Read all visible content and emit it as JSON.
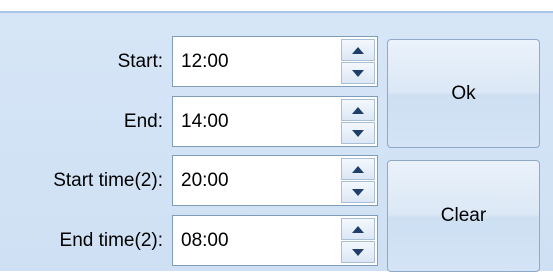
{
  "form": {
    "rows": [
      {
        "label": "Start:",
        "value": "12:00"
      },
      {
        "label": "End:",
        "value": "14:00"
      },
      {
        "label": "Start time(2):",
        "value": "20:00"
      },
      {
        "label": "End time(2):",
        "value": "08:00"
      }
    ]
  },
  "buttons": {
    "ok_label": "Ok",
    "clear_label": "Clear"
  },
  "colors": {
    "panel_background": "#cfe0f4",
    "panel_border": "#a9c4e6",
    "field_border": "#7f9db9",
    "spinner_arrow": "#1f3f68"
  },
  "icons": {
    "spin_up": "triangle-up-icon",
    "spin_down": "triangle-down-icon"
  }
}
